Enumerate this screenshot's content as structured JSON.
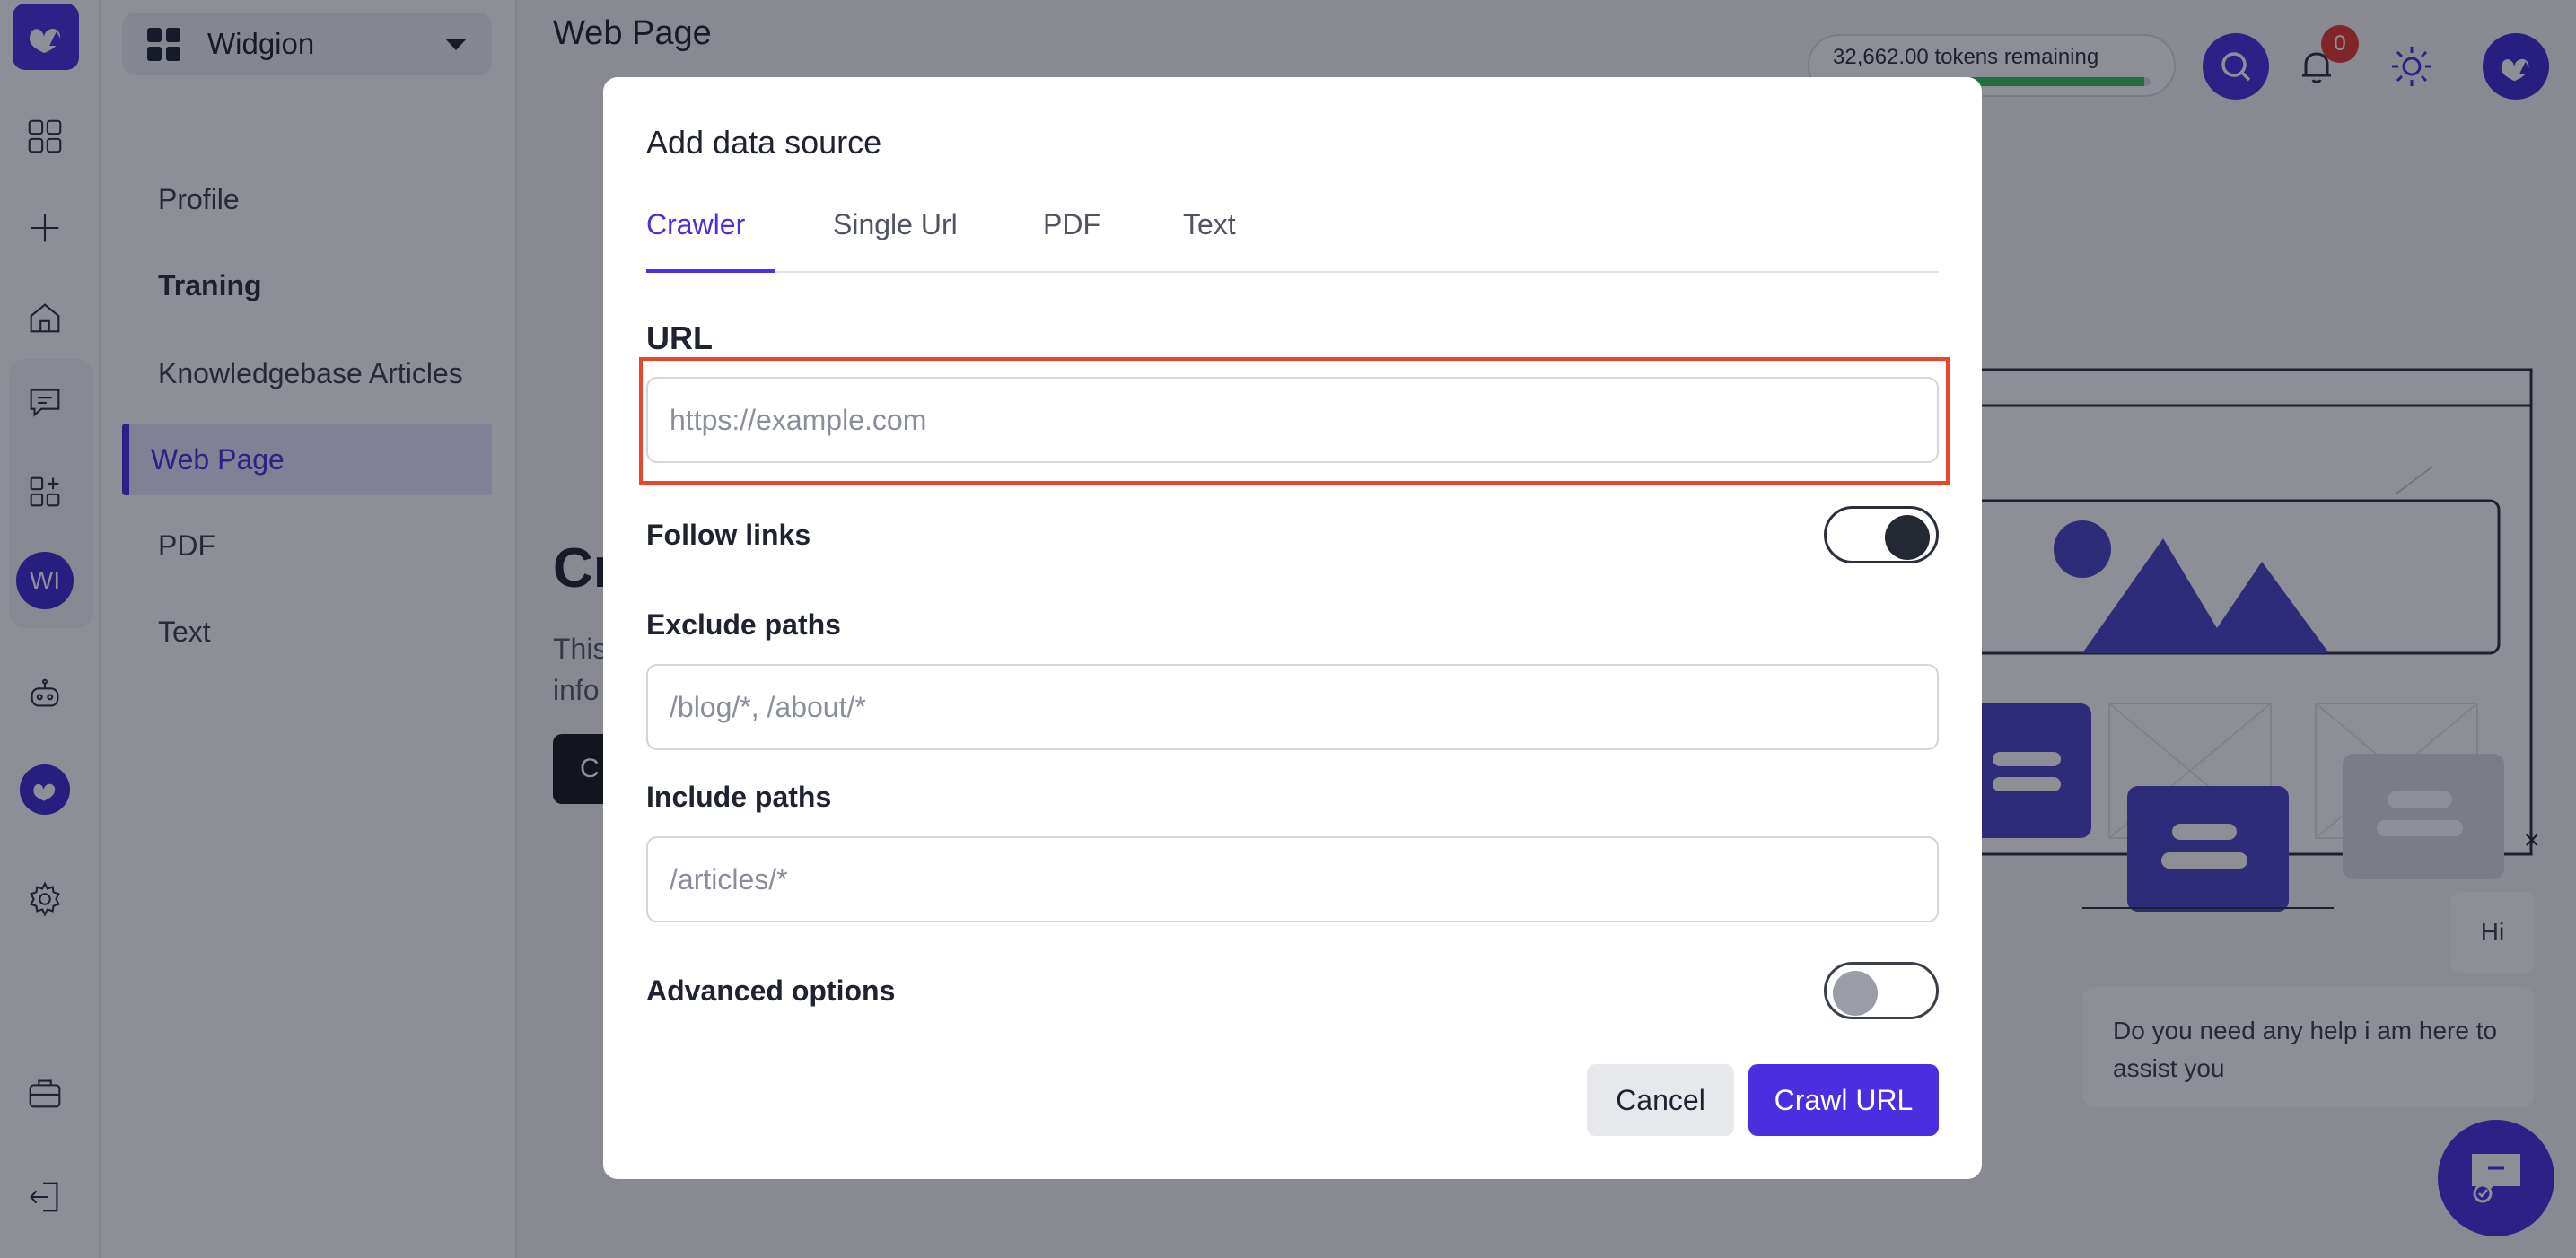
{
  "app": {
    "workspace": "Widgion",
    "page_title": "Web Page",
    "tokens_remaining": "32,662.00 tokens remaining",
    "token_fraction": 0.98,
    "notification_count": "0",
    "workspace_avatar": "WI",
    "brand_color": "#4b2ee0"
  },
  "sidebar": {
    "items": [
      {
        "label": "Profile"
      },
      {
        "label": "Traning"
      },
      {
        "label": "Knowledgebase Articles"
      },
      {
        "label": "Web Page"
      },
      {
        "label": "PDF"
      },
      {
        "label": "Text"
      }
    ]
  },
  "main": {
    "heading": "Cr",
    "description_line1": "This",
    "description_line2": "info",
    "button": "C"
  },
  "modal": {
    "title": "Add data source",
    "tabs": [
      {
        "label": "Crawler"
      },
      {
        "label": "Single Url"
      },
      {
        "label": "PDF"
      },
      {
        "label": "Text"
      }
    ],
    "url_label": "URL",
    "url_placeholder": "https://example.com",
    "follow_links_label": "Follow links",
    "exclude_label": "Exclude paths",
    "exclude_placeholder": "/blog/*, /about/*",
    "include_label": "Include paths",
    "include_placeholder": "/articles/*",
    "advanced_label": "Advanced options",
    "cancel": "Cancel",
    "submit": "Crawl URL"
  },
  "chat": {
    "hi": "Hi",
    "message": "Do you need any help i am here to assist you",
    "close_glyph": "×"
  }
}
